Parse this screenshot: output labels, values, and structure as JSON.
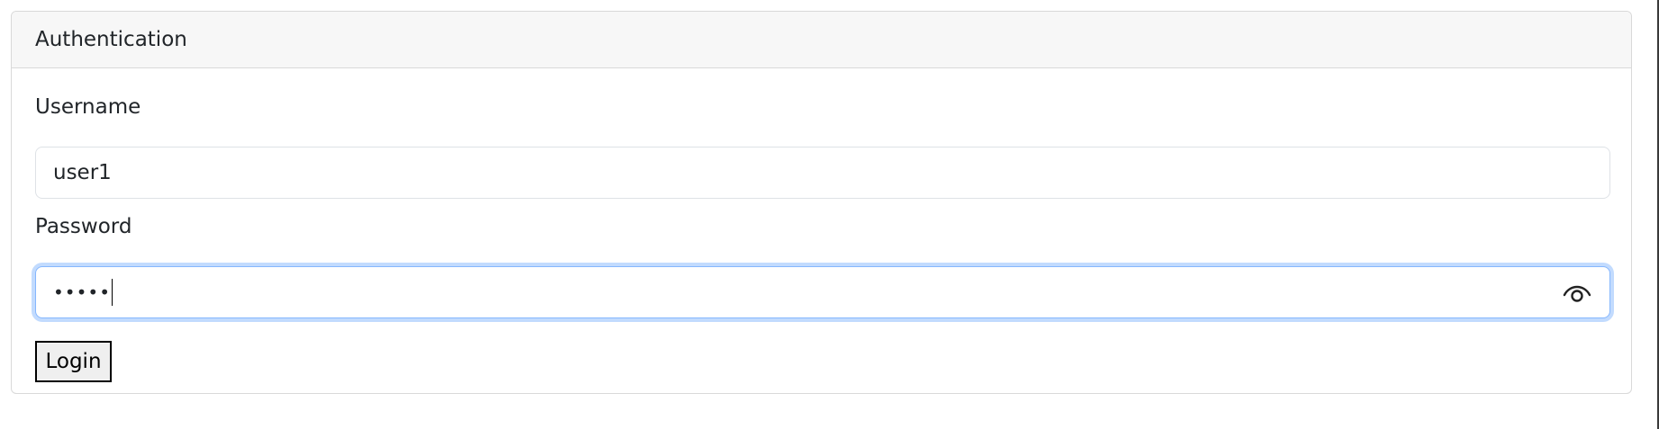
{
  "card": {
    "header": "Authentication"
  },
  "form": {
    "username_label": "Username",
    "username_value": "user1",
    "password_label": "Password",
    "password_masked": "•••••",
    "login_label": "Login"
  },
  "icons": {
    "password_toggle": "eye-icon"
  },
  "colors": {
    "focus_border": "#86b7fe",
    "header_bg": "#f7f7f7"
  }
}
